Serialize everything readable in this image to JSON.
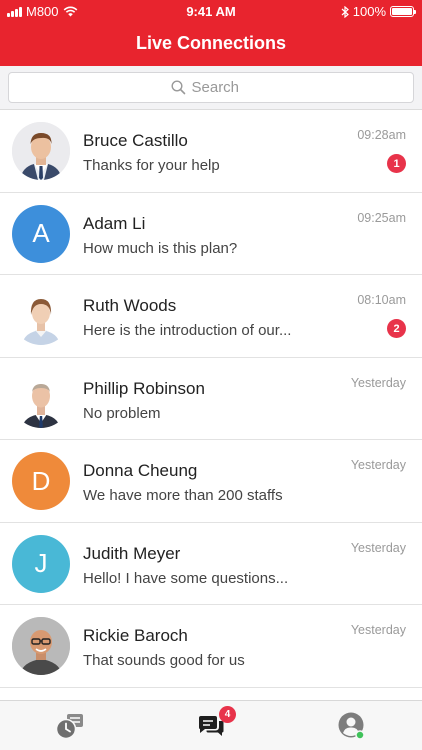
{
  "status_bar": {
    "carrier": "M800",
    "time": "9:41 AM",
    "battery": "100%"
  },
  "header": {
    "title": "Live Connections"
  },
  "search": {
    "placeholder": "Search"
  },
  "colors": {
    "brand": "#e8242e",
    "badge": "#e8334a"
  },
  "conversations": [
    {
      "name": "Bruce Castillo",
      "message": "Thanks for your help",
      "time": "09:28am",
      "unread": "1",
      "avatar": {
        "type": "photo",
        "bg": "#e9e9ec"
      }
    },
    {
      "name": "Adam Li",
      "message": "How much is this plan?",
      "time": "09:25am",
      "unread": "",
      "avatar": {
        "type": "initial",
        "letter": "A",
        "bg": "#3d8fdb"
      }
    },
    {
      "name": "Ruth Woods",
      "message": "Here is the introduction of our...",
      "time": "08:10am",
      "unread": "2",
      "avatar": {
        "type": "photo",
        "bg": "#ffffff"
      }
    },
    {
      "name": "Phillip Robinson",
      "message": "No problem",
      "time": "Yesterday",
      "unread": "",
      "avatar": {
        "type": "photo",
        "bg": "#ffffff"
      }
    },
    {
      "name": "Donna Cheung",
      "message": "We have more than 200 staffs",
      "time": "Yesterday",
      "unread": "",
      "avatar": {
        "type": "initial",
        "letter": "D",
        "bg": "#ef8a3a"
      }
    },
    {
      "name": "Judith Meyer",
      "message": "Hello! I have some questions...",
      "time": "Yesterday",
      "unread": "",
      "avatar": {
        "type": "initial",
        "letter": "J",
        "bg": "#49b8d6"
      }
    },
    {
      "name": "Rickie Baroch",
      "message": "That sounds good for us",
      "time": "Yesterday",
      "unread": "",
      "avatar": {
        "type": "photo",
        "bg": "#c9c9c9"
      }
    }
  ],
  "tabbar": {
    "tabs": [
      {
        "icon": "history-icon",
        "active": false
      },
      {
        "icon": "chats-icon",
        "active": true,
        "badge": "4"
      },
      {
        "icon": "profile-icon",
        "active": false
      }
    ]
  }
}
